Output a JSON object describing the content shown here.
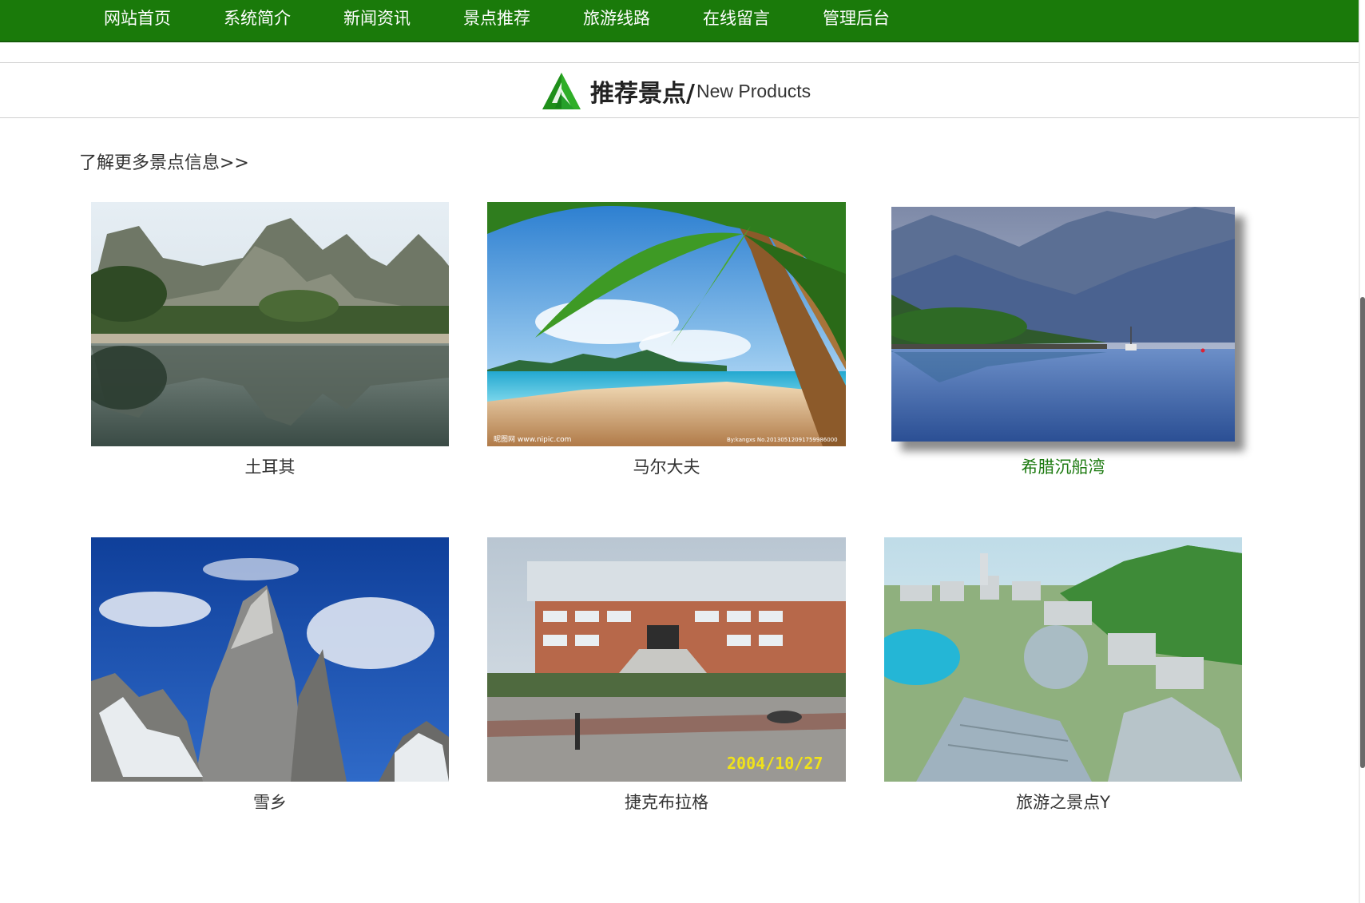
{
  "nav": {
    "items": [
      {
        "label": "网站首页"
      },
      {
        "label": "系统简介"
      },
      {
        "label": "新闻资讯"
      },
      {
        "label": "景点推荐"
      },
      {
        "label": "旅游线路"
      },
      {
        "label": "在线留言"
      },
      {
        "label": "管理后台"
      }
    ]
  },
  "section": {
    "title_cn": "推荐景点/",
    "title_en": "New Products",
    "more_link": "了解更多景点信息>>"
  },
  "spots": [
    {
      "name": "土耳其"
    },
    {
      "name": "马尔大夫",
      "watermark_left": "昵图网 www.nipic.com",
      "watermark_right": "By:kangxs No.20130512091759986000"
    },
    {
      "name": "希腊沉船湾"
    },
    {
      "name": "雪乡"
    },
    {
      "name": "捷克布拉格",
      "date_stamp": "2004/10/27"
    },
    {
      "name": "旅游之景点Y"
    }
  ],
  "colors": {
    "nav_bg": "#1a7a0a",
    "accent": "#1c7a10",
    "text": "#333333"
  },
  "icons": {
    "section_logo": "tree-icon"
  }
}
